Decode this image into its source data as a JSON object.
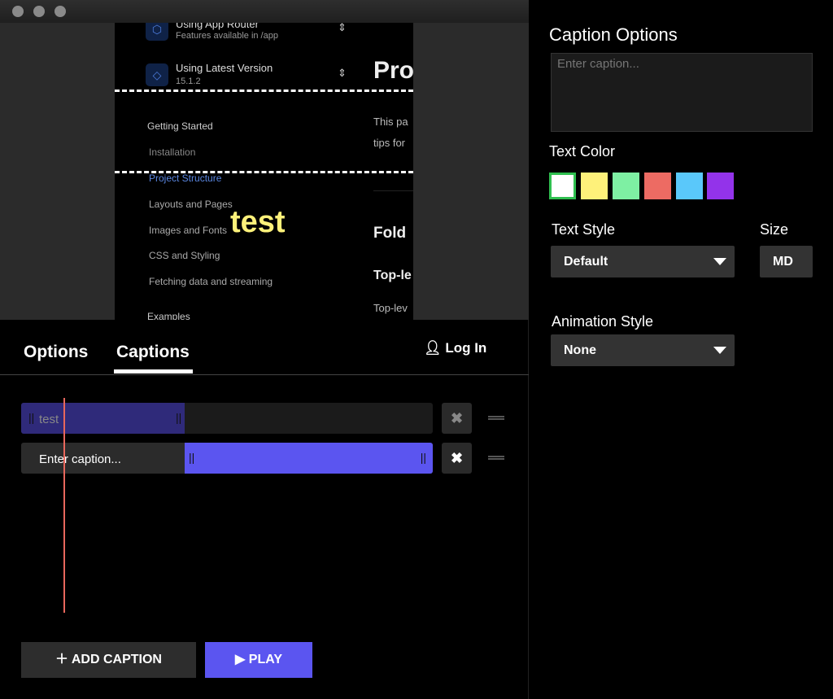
{
  "preview": {
    "nav_items": [
      {
        "title": "Using App Router",
        "subtitle": "Features available in /app"
      },
      {
        "title": "Using Latest Version",
        "subtitle": "15.1.2"
      }
    ],
    "section_heading": "Getting Started",
    "links": [
      "Installation",
      "Project Structure",
      "Layouts and Pages",
      "Images and Fonts",
      "CSS and Styling",
      "Fetching data and streaming"
    ],
    "examples_heading": "Examples",
    "content": {
      "title": "Pro",
      "para1": "This pa",
      "para2": "tips for",
      "h2": "Fold",
      "h3": "Top-le",
      "p3": "Top-lev"
    },
    "overlay_caption": "test"
  },
  "tabs": [
    {
      "label": "Options"
    },
    {
      "label": "Captions",
      "active": true
    }
  ],
  "login_label": "Log In",
  "captions": [
    {
      "text": "test",
      "placeholder": "Enter caption..."
    },
    {
      "text": "",
      "placeholder": "Enter caption..."
    }
  ],
  "buttons": {
    "add_caption": "ADD CAPTION",
    "play": "PLAY"
  },
  "panel": {
    "title": "Caption Options",
    "caption_placeholder": "Enter caption...",
    "text_color_label": "Text Color",
    "colors": [
      "#ffffff",
      "#fef17a",
      "#7ef0a3",
      "#ed6b63",
      "#5ac8fa",
      "#9333ea"
    ],
    "selected_color": "#ffffff",
    "text_style_label": "Text Style",
    "text_style_value": "Default",
    "size_label": "Size",
    "size_value": "MD",
    "animation_label": "Animation Style",
    "animation_value": "None"
  },
  "colors": {
    "accent": "#5b55f0",
    "accent_dim": "#2f2a7a",
    "playhead": "#e8675c"
  }
}
